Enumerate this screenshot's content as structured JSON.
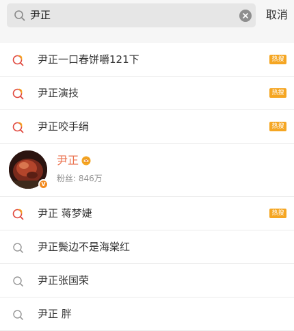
{
  "search": {
    "query": "尹正",
    "cancel_label": "取消"
  },
  "colors": {
    "hot_badge": "#f5a623",
    "accent_name": "#eb7350",
    "trend_icon_red": "#e0473d",
    "trend_icon_orange": "#f5a623"
  },
  "suggestions_top": [
    {
      "label": "尹正一口春饼嚼121下",
      "icon": "trending-search-icon",
      "badge": "热搜"
    },
    {
      "label": "尹正演技",
      "icon": "trending-search-icon",
      "badge": "热搜"
    },
    {
      "label": "尹正咬手绢",
      "icon": "trending-search-icon",
      "badge": "热搜"
    }
  ],
  "user_result": {
    "name": "尹正",
    "fans_text": "粉丝: 846万",
    "verified_badge": "V"
  },
  "suggestions_bottom": [
    {
      "label": "尹正 蒋梦婕",
      "icon": "trending-search-icon",
      "badge": "热搜"
    },
    {
      "label": "尹正鬓边不是海棠红",
      "icon": "search-icon",
      "badge": ""
    },
    {
      "label": "尹正张国荣",
      "icon": "search-icon",
      "badge": ""
    },
    {
      "label": "尹正 胖",
      "icon": "search-icon",
      "badge": ""
    }
  ]
}
